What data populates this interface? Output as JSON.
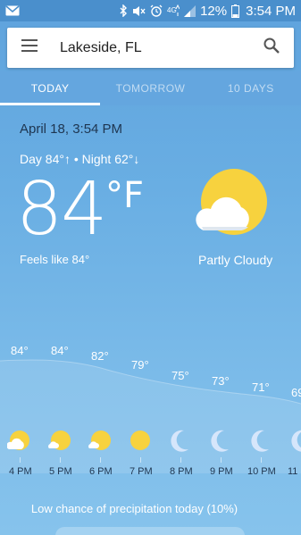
{
  "status_bar": {
    "battery_percent": "12%",
    "time": "3:54 PM",
    "icons": [
      "gmail-icon",
      "bluetooth-icon",
      "mute-icon",
      "alarm-icon",
      "4g-lte-icon",
      "signal-icon",
      "battery-icon"
    ]
  },
  "search": {
    "location": "Lakeside, FL",
    "icons": [
      "hamburger-menu-icon",
      "search-icon"
    ]
  },
  "tabs": [
    {
      "label": "TODAY",
      "active": true
    },
    {
      "label": "TOMORROW",
      "active": false
    },
    {
      "label": "10 DAYS",
      "active": false
    }
  ],
  "current": {
    "date": "April 18, 3:54 PM",
    "day_night": "Day 84°↑ • Night 62°↓",
    "temperature": "84",
    "unit": "°F",
    "feels_like": "Feels like 84°",
    "condition": "Partly Cloudy",
    "condition_icon": "partly-cloudy-icon"
  },
  "hourly": [
    {
      "time": "4 PM",
      "temp": "84°",
      "icon": "partly-cloudy-icon"
    },
    {
      "time": "5 PM",
      "temp": "84°",
      "icon": "sun-cloud-icon"
    },
    {
      "time": "6 PM",
      "temp": "82°",
      "icon": "sun-cloud-icon"
    },
    {
      "time": "7 PM",
      "temp": "79°",
      "icon": "sun-icon"
    },
    {
      "time": "8 PM",
      "temp": "75°",
      "icon": "moon-icon"
    },
    {
      "time": "9 PM",
      "temp": "73°",
      "icon": "moon-icon"
    },
    {
      "time": "10 PM",
      "temp": "71°",
      "icon": "moon-icon"
    },
    {
      "time": "11",
      "temp": "69",
      "icon": "moon-icon"
    }
  ],
  "precipitation": "Low chance of precipitation today (10%)",
  "colors": {
    "sky": "#69aee3",
    "sun": "#f7d23e",
    "moon": "#d6e6fb",
    "dark_text": "#1e3550"
  }
}
